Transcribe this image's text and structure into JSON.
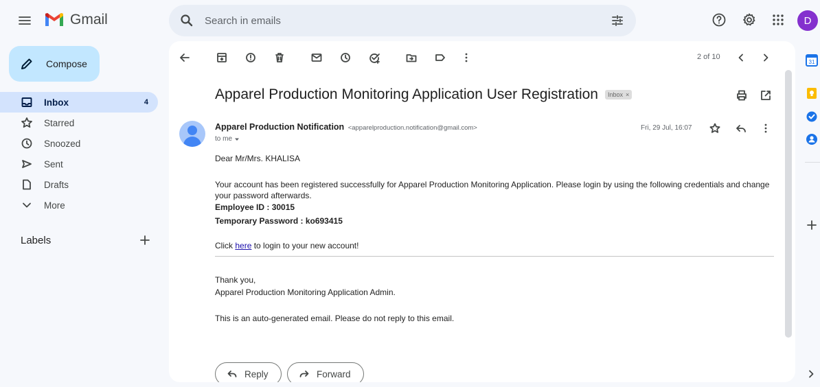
{
  "app": {
    "name": "Gmail",
    "avatar_letter": "D"
  },
  "search": {
    "placeholder": "Search in emails"
  },
  "compose": {
    "label": "Compose"
  },
  "nav": [
    {
      "label": "Inbox",
      "count": "4"
    },
    {
      "label": "Starred"
    },
    {
      "label": "Snoozed"
    },
    {
      "label": "Sent"
    },
    {
      "label": "Drafts"
    },
    {
      "label": "More"
    }
  ],
  "labels_heading": "Labels",
  "pager": "2 of 10",
  "email": {
    "subject": "Apparel Production Monitoring Application User Registration",
    "chip": "Inbox",
    "sender_name": "Apparel Production Notification",
    "sender_email": "<apparelproduction.notification@gmail.com>",
    "to": "to me",
    "date": "Fri, 29 Jul, 16:07",
    "greeting": "Dear Mr/Mrs. KHALISA",
    "para1": "Your account has been registered successfully for Apparel Production Monitoring Application. Please login by using the following credentials and change your password afterwards.",
    "employee_id": "Employee ID : 30015",
    "temp_password": "Temporary Password : ko693415",
    "click_prefix": "Click ",
    "click_link": "here",
    "click_suffix": " to login to your new account!",
    "thanks": "Thank you,",
    "signature": "Apparel Production Monitoring Application Admin.",
    "footer": "This is an auto-generated email. Please do not reply to this email."
  },
  "actions": {
    "reply": "Reply",
    "forward": "Forward"
  },
  "colors": {
    "accent": "#c2e7ff",
    "active_nav": "#d3e3fd",
    "avatar": "#8430ce",
    "link": "#1a0dab"
  }
}
